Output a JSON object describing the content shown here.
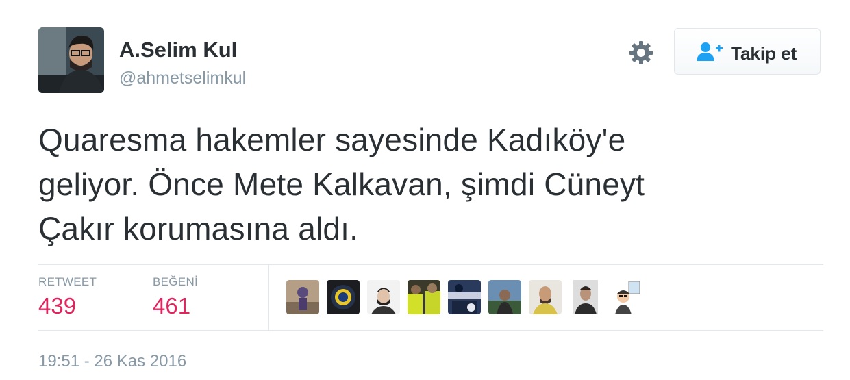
{
  "user": {
    "display_name": "A.Selim Kul",
    "screen_name": "@ahmetselimkul",
    "avatar_icon": "user-avatar"
  },
  "actions": {
    "follow_label": "Takip et",
    "follow_icon": "add-user-icon",
    "settings_icon": "gear-icon"
  },
  "tweet": {
    "lines": [
      "Quaresma hakemler sayesinde Kadıköy'e",
      "geliyor. Önce Mete Kalkavan, şimdi Cüneyt",
      "Çakır korumasına aldı."
    ]
  },
  "stats": {
    "retweets": {
      "label": "RETWEET",
      "value": "439"
    },
    "likes": {
      "label": "BEĞENİ",
      "value": "461"
    }
  },
  "favoriters_count": 9,
  "timestamp": "19:51 - 26 Kas 2016",
  "colors": {
    "stat_value": "#e0245e",
    "muted": "#8899a6",
    "accent": "#1da1f2",
    "text": "#292f33"
  }
}
